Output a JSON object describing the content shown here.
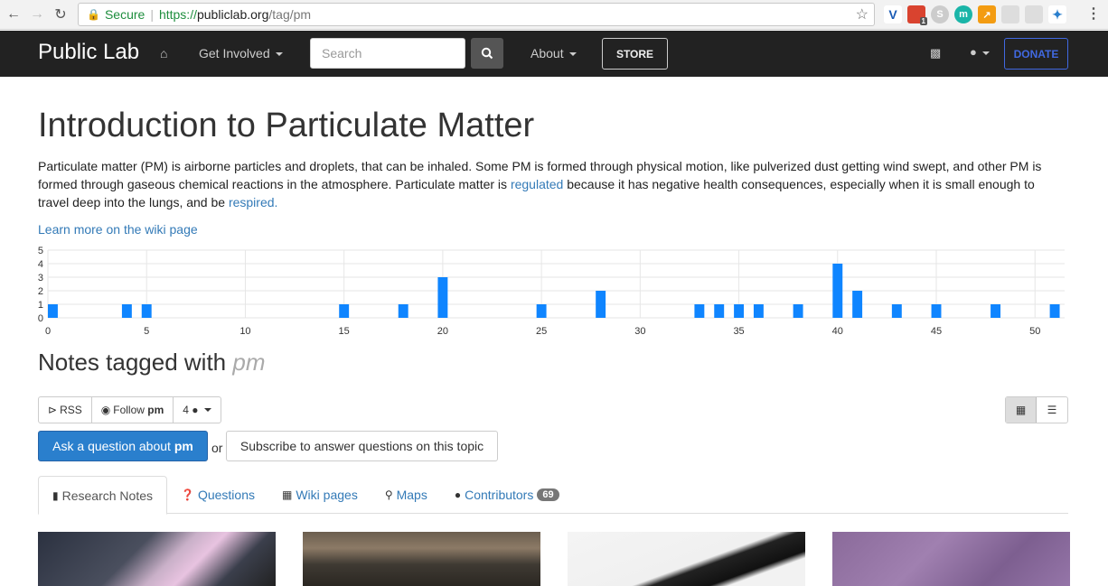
{
  "browser": {
    "secure_label": "Secure",
    "url_scheme": "https://",
    "url_host": "publiclab.org",
    "url_path": "/tag/pm",
    "ext_badge": "1"
  },
  "navbar": {
    "brand": "Public Lab",
    "get_involved": "Get Involved",
    "search_placeholder": "Search",
    "about": "About",
    "store": "STORE",
    "donate": "DONATE"
  },
  "page": {
    "title": "Introduction to Particulate Matter",
    "description_1": "Particulate matter (PM) is airborne particles and droplets, that can be inhaled. Some PM is formed through physical motion, like pulverized dust getting wind swept, and other PM is formed through gaseous chemical reactions in the atmosphere. Particulate matter is ",
    "regulated_link": "regulated",
    "description_2": " because it has negative health consequences, especially when it is small enough to travel deep into the lungs, and be ",
    "respired_link": "respired.",
    "learn_more": "Learn more on the wiki page"
  },
  "chart_data": {
    "type": "bar",
    "x": [
      0,
      4,
      5,
      15,
      18,
      20,
      25,
      28,
      33,
      34,
      35,
      36,
      38,
      40,
      41,
      43,
      45,
      48,
      51
    ],
    "values": [
      1,
      1,
      1,
      1,
      1,
      3,
      1,
      2,
      1,
      1,
      1,
      1,
      1,
      4,
      2,
      1,
      1,
      1,
      1
    ],
    "xlim": [
      0,
      51.5
    ],
    "ylim": [
      0,
      5
    ],
    "xticks": [
      0,
      5,
      10,
      15,
      20,
      25,
      30,
      35,
      40,
      45,
      50
    ],
    "yticks": [
      0,
      1,
      2,
      3,
      4,
      5
    ],
    "color": "#0f85ff",
    "grid": true
  },
  "notes": {
    "heading": "Notes tagged with",
    "tag": "pm",
    "rss": "RSS",
    "follow": "Follow",
    "follow_tag": "pm",
    "follower_count": "4",
    "ask_label": "Ask a question about",
    "ask_tag": "pm",
    "or": "or",
    "subscribe": "Subscribe to answer questions on this topic"
  },
  "tabs": [
    {
      "label": "Research Notes",
      "icon": "file-icon"
    },
    {
      "label": "Questions",
      "icon": "question-icon"
    },
    {
      "label": "Wiki pages",
      "icon": "book-icon"
    },
    {
      "label": "Maps",
      "icon": "map-marker-icon"
    },
    {
      "label": "Contributors",
      "icon": "user-icon",
      "badge": "69"
    }
  ],
  "colors": {
    "navbar_bg": "#222222",
    "link": "#337ab7",
    "primary_button": "#2a7fcd",
    "donate": "#4169e1",
    "bar": "#0f85ff"
  }
}
